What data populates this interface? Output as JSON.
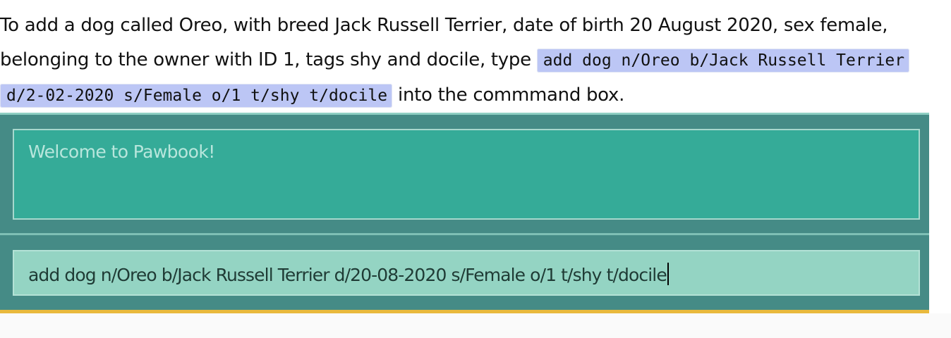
{
  "instruction": {
    "prefix": "To add a dog called Oreo, with breed Jack Russell Terrier, date of birth 20 August 2020, sex female, belonging to the owner with ID 1, tags shy and docile, type",
    "code": "add dog n/Oreo b/Jack Russell Terrier d/2-02-2020 s/Female o/1 t/shy t/docile",
    "suffix": "into the commmand box."
  },
  "app": {
    "result_text": "Welcome to Pawbook!",
    "command_value": "add dog n/Oreo b/Jack Russell Terrier d/20-08-2020 s/Female o/1 t/shy t/docile"
  },
  "colors": {
    "app_background": "#458b86",
    "result_box": "#35ab98",
    "command_box": "#94d4c3",
    "status_bar": "#e9b93d",
    "code_highlight": "#bcc6f5"
  }
}
